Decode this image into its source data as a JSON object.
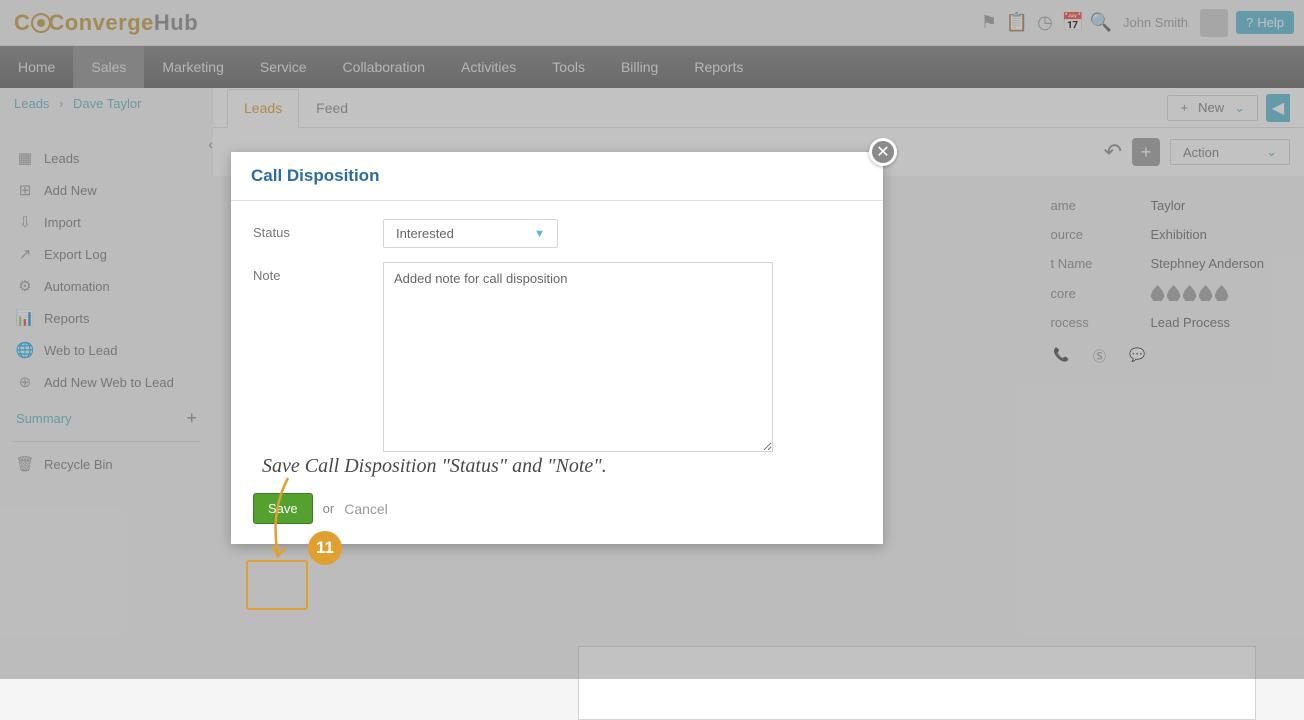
{
  "header": {
    "logo_converge": "Converge",
    "logo_hub": "Hub",
    "user_name": "John Smith",
    "help_label": "Help"
  },
  "nav": {
    "items": [
      "Home",
      "Sales",
      "Marketing",
      "Service",
      "Collaboration",
      "Activities",
      "Tools",
      "Billing",
      "Reports"
    ],
    "active_index": 1
  },
  "breadcrumb": {
    "root": "Leads",
    "current": "Dave Taylor"
  },
  "sidebar": {
    "items": [
      {
        "icon": "list-icon",
        "label": "Leads"
      },
      {
        "icon": "add-icon",
        "label": "Add New"
      },
      {
        "icon": "import-icon",
        "label": "Import"
      },
      {
        "icon": "export-icon",
        "label": "Export Log"
      },
      {
        "icon": "automation-icon",
        "label": "Automation"
      },
      {
        "icon": "reports-icon",
        "label": "Reports"
      },
      {
        "icon": "web-icon",
        "label": "Web to Lead"
      },
      {
        "icon": "add-web-icon",
        "label": "Add New Web to Lead"
      }
    ],
    "section_label": "Summary",
    "recycle_label": "Recycle Bin"
  },
  "tabs": {
    "items": [
      "Leads",
      "Feed"
    ],
    "active_index": 0
  },
  "controls": {
    "new_label": "New",
    "action_label": "Action"
  },
  "details": {
    "rows": [
      {
        "label": "Last Name",
        "value": "Taylor"
      },
      {
        "label": "Source",
        "value": "Exhibition"
      },
      {
        "label": "Assistant Name",
        "value": "Stephney Anderson"
      },
      {
        "label": "Score",
        "value": ""
      },
      {
        "label": "Process",
        "value": "Lead Process"
      }
    ]
  },
  "modal": {
    "title": "Call Disposition",
    "status_label": "Status",
    "status_value": "Interested",
    "note_label": "Note",
    "note_value": "Added note for call disposition",
    "save_label": "Save",
    "or_text": "or",
    "cancel_label": "Cancel"
  },
  "annotation": {
    "text": "Save Call Disposition \"Status\" and \"Note\".",
    "step_number": "11"
  }
}
